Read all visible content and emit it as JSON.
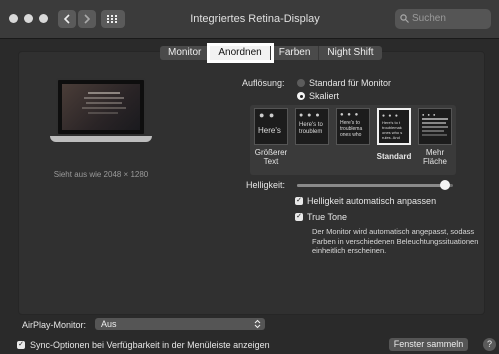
{
  "window": {
    "title": "Integriertes Retina-Display",
    "search_placeholder": "Suchen"
  },
  "tabs": [
    {
      "label": "Monitor",
      "selected": false
    },
    {
      "label": "Anordnen",
      "selected": true
    },
    {
      "label": "Farben",
      "selected": false
    },
    {
      "label": "Night Shift",
      "selected": false
    }
  ],
  "display": {
    "caption": "Sieht aus wie 2048 × 1280"
  },
  "resolution": {
    "label": "Auflösung:",
    "options": [
      {
        "label": "Standard für Monitor",
        "selected": false
      },
      {
        "label": "Skaliert",
        "selected": true
      }
    ],
    "scale_options": [
      {
        "preview": "Here's",
        "label": "Größerer\nText",
        "selected": false
      },
      {
        "preview": "Here's to\ntroublem",
        "label": "",
        "selected": false
      },
      {
        "preview": "Here's to\ntroublema\nones who",
        "label": "",
        "selected": false
      },
      {
        "preview": "Here's to t\ntroublemak\nones who s\nrules. And",
        "label": "Standard",
        "selected": true
      },
      {
        "preview": "",
        "label": "Mehr\nFläche",
        "selected": false
      }
    ]
  },
  "brightness": {
    "label": "Helligkeit:",
    "level": 0.95,
    "auto_label": "Helligkeit automatisch anpassen",
    "auto_checked": true,
    "true_tone_label": "True Tone",
    "true_tone_checked": true,
    "true_tone_desc": "Der Monitor wird automatisch angepasst, sodass Farben in verschiedenen Beleuchtungssituationen einheitlich erscheinen."
  },
  "airplay": {
    "label": "AirPlay-Monitor:",
    "value": "Aus"
  },
  "sync": {
    "label": "Sync-Optionen bei Verfügbarkeit in der Menüleiste anzeigen",
    "checked": true
  },
  "buttons": {
    "gather": "Fenster sammeln",
    "help": "?"
  },
  "colors": {
    "highlight": "#ffffff",
    "window_bg": "#2a2a2a"
  }
}
